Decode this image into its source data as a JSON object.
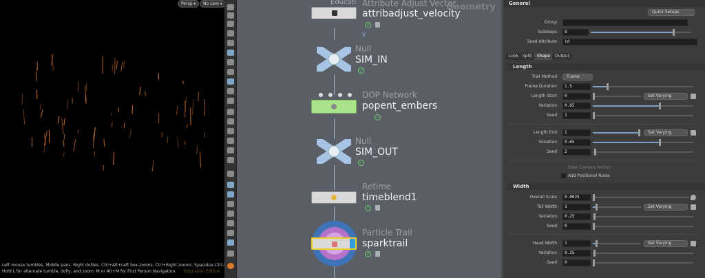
{
  "viewport": {
    "persp_label": "Persp ▾",
    "cam_label": "No cam ▾",
    "help_line1": "Left mouse tumbles. Middle pans. Right dollies. Ctrl+Alt+Left box-zooms. Ctrl+Right zooms. Spacebar-Ctrl-Left tilts.",
    "help_line2": "Hold L for alternate tumble, dolly, and zoom.   M or Alt+M for First Person Navigation.",
    "edition": "Education Edition",
    "spark_color": "#e07a2a"
  },
  "network": {
    "context_label": "Geometry",
    "wire_flag": "V",
    "nodes": [
      {
        "type": "Attribute Adjust Vector",
        "name": "attribadjust_velocity"
      },
      {
        "type": "Null",
        "name": "SIM_IN"
      },
      {
        "type": "DOP Network",
        "name": "popent_embers"
      },
      {
        "type": "Null",
        "name": "SIM_OUT"
      },
      {
        "type": "Retime",
        "name": "timeblend1"
      },
      {
        "type": "Particle Trail",
        "name": "sparktrail"
      }
    ],
    "partial_label": "Educati"
  },
  "params": {
    "general_header": "General",
    "quick_setups": "Quick Setups",
    "group_label": "Group",
    "substeps_label": "Substeps",
    "substeps_value": "8",
    "seed_attr_label": "Seed Attribute",
    "seed_attr_value": "id",
    "tabs": [
      "Look",
      "Split",
      "Shape",
      "Output"
    ],
    "length_header": "Length",
    "trail_method_label": "Trail Method",
    "trail_method_value": "Frame",
    "frame_duration_label": "Frame Duration",
    "frame_duration_value": "1.5",
    "length_start_label": "Length Start",
    "length_start_value": "0",
    "set_varying": "Set Varying",
    "variation_label": "Variation",
    "variation1_value": "0.65",
    "seed_label": "Seed",
    "seed1_value": "1",
    "length_end_label": "Length End",
    "length_end_value": "1",
    "variation2_value": "0.65",
    "seed2_value": "2",
    "bake_camera": "Bake Camera Motion",
    "add_noise": "Add Positional Noise",
    "width_header": "Width",
    "overall_scale_label": "Overall Scale",
    "overall_scale_value": "0.0025",
    "tail_width_label": "Tail Width",
    "tail_width_value": "1",
    "variation3_value": "0.25",
    "seed3_value": "0",
    "head_width_label": "Head Width",
    "head_width_value": "1",
    "variation4_value": "0.25",
    "seed4_value": "0"
  }
}
